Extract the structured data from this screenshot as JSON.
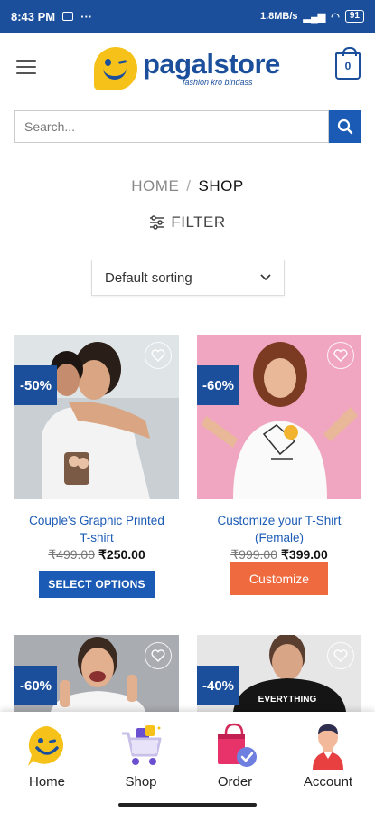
{
  "status_bar": {
    "time": "8:43 PM",
    "network_speed": "1.8MB/s",
    "battery": "91"
  },
  "brand": {
    "name_part1": "pagal",
    "name_part2": "store",
    "tagline": "fashion kro bindass",
    "primary_color": "#1b4f9c",
    "accent_color": "#f6c21a"
  },
  "cart": {
    "count": "0"
  },
  "search": {
    "placeholder": "Search..."
  },
  "breadcrumb": {
    "home": "HOME",
    "separator": "/",
    "current": "SHOP"
  },
  "filter": {
    "label": "FILTER"
  },
  "sorting": {
    "selected": "Default sorting"
  },
  "products": [
    {
      "discount": "-50%",
      "name_line1": "Couple's Graphic Printed",
      "name_line2": "T-shirt",
      "old_price": "₹499.00",
      "new_price": "₹250.00",
      "button": "SELECT OPTIONS"
    },
    {
      "discount": "-60%",
      "name_line1": "Customize your T-Shirt",
      "name_line2": "(Female)",
      "old_price": "₹999.00",
      "new_price": "₹399.00",
      "button": "Customize"
    },
    {
      "discount": "-60%"
    },
    {
      "discount": "-40%",
      "shirt_print": "EVERYTHING"
    }
  ],
  "bottom_nav": [
    {
      "label": "Home",
      "icon": "smiley-logo-icon"
    },
    {
      "label": "Shop",
      "icon": "shopping-cart-icon"
    },
    {
      "label": "Order",
      "icon": "shopping-bag-check-icon"
    },
    {
      "label": "Account",
      "icon": "user-avatar-icon"
    }
  ]
}
